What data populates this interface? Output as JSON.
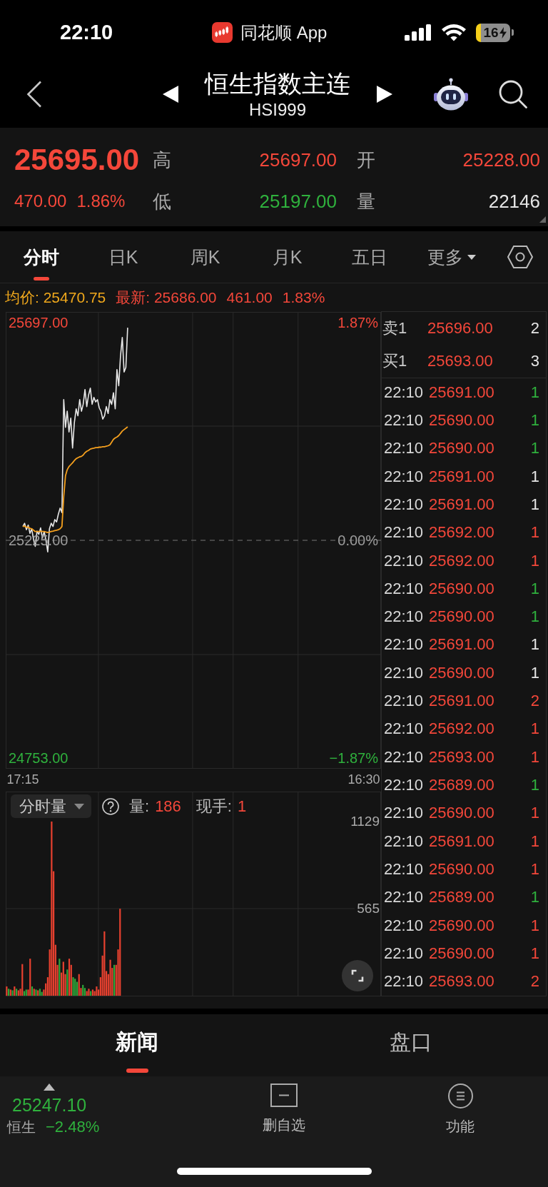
{
  "status_bar": {
    "time": "22:10",
    "app_label": "同花顺 App",
    "battery": "16"
  },
  "header": {
    "title": "恒生指数主连",
    "code": "HSI999"
  },
  "quote": {
    "price": "25695.00",
    "change": "470.00",
    "change_percent": "1.86%",
    "stats": [
      {
        "label": "高",
        "value": "25697.00",
        "color": "#f4473a"
      },
      {
        "label": "开",
        "value": "25228.00",
        "color": "#f4473a"
      },
      {
        "label": "低",
        "value": "25197.00",
        "color": "#2fb13d"
      },
      {
        "label": "量",
        "value": "22146",
        "color": "#e6e6e6"
      }
    ]
  },
  "chart_tabs": [
    {
      "label": "分时",
      "selected": true,
      "kind": "tab"
    },
    {
      "label": "日K",
      "selected": false,
      "kind": "tab"
    },
    {
      "label": "周K",
      "selected": false,
      "kind": "tab"
    },
    {
      "label": "月K",
      "selected": false,
      "kind": "tab"
    },
    {
      "label": "五日",
      "selected": false,
      "kind": "tab"
    },
    {
      "label": "更多",
      "selected": false,
      "kind": "menu"
    }
  ],
  "summary": {
    "average": "均价: 25470.75",
    "latest": "最新: 25686.00",
    "latest_change": "461.00",
    "latest_percent": "1.83%"
  },
  "price_chart": {
    "percent_labels": [
      {
        "text": "1.87%",
        "color": "#f4473a"
      },
      {
        "text": "0.00%",
        "color": "#9c9c9c"
      },
      {
        "text": "−1.87%",
        "color": "#2fb13d"
      }
    ],
    "chart_data": {
      "type": "line",
      "categories": [
        "17:15",
        null,
        null,
        null,
        null,
        null,
        null,
        null,
        null,
        null,
        null,
        null,
        null,
        null,
        null,
        null,
        null,
        null,
        null,
        null,
        null,
        null,
        null,
        null,
        null,
        null,
        null,
        null,
        null,
        null,
        null,
        null,
        null,
        null,
        null,
        null,
        null,
        null,
        null,
        null,
        null,
        null,
        null,
        null,
        null,
        null,
        null,
        null,
        null,
        null,
        null,
        null,
        null,
        null,
        null,
        null,
        null,
        null,
        null,
        null,
        null,
        null,
        null,
        null,
        null,
        null,
        null,
        null,
        null,
        null,
        null,
        null,
        null,
        null,
        null,
        null,
        null,
        null,
        null,
        null,
        null,
        null,
        null,
        null,
        null,
        null,
        null,
        null,
        null,
        null,
        null,
        null,
        null,
        null,
        null,
        null,
        null,
        null,
        null,
        null,
        null,
        null,
        null,
        null,
        null,
        null,
        null,
        null,
        null,
        null,
        null,
        null,
        null,
        null,
        null,
        null,
        null,
        null,
        null,
        null,
        null,
        null,
        null,
        null,
        null,
        null,
        null,
        null,
        null,
        null,
        null,
        null,
        null,
        null,
        null,
        null,
        null,
        null,
        null,
        null,
        null,
        null,
        null,
        null,
        null,
        null,
        null,
        null,
        null,
        null,
        null,
        null,
        null,
        null,
        null,
        null,
        null,
        null,
        null,
        null,
        null,
        null,
        null,
        null,
        null,
        null,
        null,
        null,
        null,
        null,
        null,
        null,
        null,
        null,
        null,
        null,
        null,
        null,
        null,
        null,
        null,
        null,
        null,
        null,
        null,
        null,
        null,
        null,
        null,
        null,
        null,
        null,
        "16:30"
      ],
      "ylim": [
        24753,
        25697
      ],
      "yticks": [
        {
          "value": 25697,
          "label": "25697.00"
        },
        {
          "value": 25225,
          "label": "25225.00"
        },
        {
          "value": 24753,
          "label": "24753.00"
        }
      ],
      "ref_lines": [
        {
          "axis": "y",
          "value": 25225
        }
      ],
      "series": [
        {
          "color": "#e8e8e8",
          "values": [
            25255,
            25262,
            25248,
            25258,
            25240,
            25250,
            25228,
            25212,
            25245,
            25238,
            25252,
            25230,
            25244,
            25225,
            25200,
            25250,
            25262,
            25255,
            25270,
            25265,
            25282,
            25295,
            25285,
            25530,
            25470,
            25505,
            25460,
            25490,
            25425,
            25480,
            25510,
            25495,
            25530,
            25505,
            25520,
            25552,
            25515,
            25540,
            25555,
            25520,
            25535,
            25525,
            25530,
            25512,
            25505,
            25488,
            25495,
            25515,
            25500,
            25530,
            25520,
            25545,
            25510,
            25595,
            25560,
            25625,
            25665,
            25590,
            25600,
            25686,
            null,
            null,
            null,
            null,
            null,
            null,
            null,
            null,
            null,
            null,
            null,
            null,
            null,
            null,
            null,
            null,
            null,
            null,
            null,
            null,
            null,
            null,
            null,
            null,
            null,
            null,
            null,
            null,
            null,
            null,
            null,
            null,
            null,
            null,
            null,
            null,
            null,
            null,
            null,
            null,
            null,
            null,
            null,
            null,
            null,
            null,
            null,
            null,
            null,
            null,
            null,
            null,
            null,
            null,
            null,
            null,
            null,
            null,
            null,
            null,
            null,
            null,
            null,
            null,
            null,
            null,
            null,
            null,
            null,
            null,
            null,
            null,
            null,
            null,
            null,
            null,
            null,
            null,
            null,
            null,
            null,
            null,
            null,
            null,
            null,
            null,
            null,
            null,
            null,
            null,
            null,
            null,
            null,
            null,
            null,
            null,
            null,
            null,
            null,
            null,
            null,
            null,
            null,
            null,
            null,
            null,
            null,
            null,
            null,
            null,
            null,
            null,
            null,
            null,
            null,
            null,
            null,
            null,
            null,
            null,
            null,
            null,
            null,
            null,
            null,
            null,
            null,
            null,
            null,
            null,
            null,
            null,
            null
          ]
        },
        {
          "color": "#f5a01e",
          "values": [
            25255,
            25256,
            25253,
            25254,
            25251,
            25250,
            25247,
            25244,
            25244,
            25244,
            25245,
            25244,
            25244,
            25243,
            25242,
            25243,
            25244,
            25245,
            25246,
            25247,
            25248,
            25250,
            25255,
            25320,
            25365,
            25378,
            25385,
            25389,
            25393,
            25398,
            25402,
            25404,
            25406,
            25407,
            25410,
            25415,
            25418,
            25420,
            25423,
            25424,
            25425,
            25426,
            25426,
            25427,
            25427,
            25428,
            25428,
            25429,
            25430,
            25432,
            25438,
            25444,
            25447,
            25449,
            25452,
            25457,
            25462,
            25465,
            25468,
            25471,
            null,
            null,
            null,
            null,
            null,
            null,
            null,
            null,
            null,
            null,
            null,
            null,
            null,
            null,
            null,
            null,
            null,
            null,
            null,
            null,
            null,
            null,
            null,
            null,
            null,
            null,
            null,
            null,
            null,
            null,
            null,
            null,
            null,
            null,
            null,
            null,
            null,
            null,
            null,
            null,
            null,
            null,
            null,
            null,
            null,
            null,
            null,
            null,
            null,
            null,
            null,
            null,
            null,
            null,
            null,
            null,
            null,
            null,
            null,
            null,
            null,
            null,
            null,
            null,
            null,
            null,
            null,
            null,
            null,
            null,
            null,
            null,
            null,
            null,
            null,
            null,
            null,
            null,
            null,
            null,
            null,
            null,
            null,
            null,
            null,
            null,
            null,
            null,
            null,
            null,
            null,
            null,
            null,
            null,
            null,
            null,
            null,
            null,
            null,
            null,
            null,
            null,
            null,
            null,
            null,
            null,
            null,
            null,
            null,
            null,
            null,
            null,
            null,
            null,
            null,
            null,
            null,
            null,
            null,
            null,
            null,
            null,
            null,
            null,
            null,
            null,
            null,
            null,
            null,
            null,
            null,
            null,
            null
          ]
        }
      ]
    }
  },
  "volume_chart": {
    "selector": "分时量",
    "volume_label": "量:",
    "volume_value": "186",
    "hand_label": "现手:",
    "hand_value": "1",
    "chart_data": {
      "type": "bar",
      "stacked": true,
      "categories": [
        null,
        null,
        null,
        null,
        null,
        null,
        null,
        null,
        null,
        null,
        null,
        null,
        null,
        null,
        null,
        null,
        null,
        null,
        null,
        null,
        null,
        null,
        null,
        null,
        null,
        null,
        null,
        null,
        null,
        null,
        null,
        null,
        null,
        null,
        null,
        null,
        null,
        null,
        null,
        null,
        null,
        null,
        null,
        null,
        null,
        null,
        null,
        null,
        null,
        null,
        null,
        null,
        null,
        null,
        null,
        null,
        null,
        null,
        null,
        null,
        null,
        null,
        null,
        null,
        null,
        null,
        null,
        null,
        null,
        null,
        null,
        null,
        null,
        null,
        null,
        null,
        null,
        null,
        null,
        null,
        null,
        null,
        null,
        null,
        null,
        null,
        null,
        null,
        null,
        null,
        null,
        null,
        null,
        null,
        null,
        null,
        null,
        null,
        null,
        null,
        null,
        null,
        null,
        null,
        null,
        null,
        null,
        null,
        null,
        null,
        null,
        null,
        null,
        null,
        null,
        null,
        null,
        null,
        null,
        null,
        null,
        null,
        null,
        null,
        null,
        null,
        null,
        null,
        null,
        null,
        null,
        null,
        null,
        null,
        null,
        null,
        null,
        null,
        null,
        null,
        null,
        null,
        null,
        null,
        null,
        null,
        null,
        null,
        null,
        null,
        null,
        null,
        null,
        null,
        null,
        null,
        null,
        null,
        null,
        null,
        null,
        null,
        null,
        null,
        null,
        null,
        null,
        null,
        null,
        null,
        null,
        null,
        null,
        null,
        null,
        null,
        null,
        null,
        null,
        null,
        null,
        null,
        null,
        null,
        null,
        null,
        null,
        null,
        null,
        null,
        null,
        null
      ],
      "ylim": [
        0,
        1129
      ],
      "yticks": [
        565,
        1129
      ],
      "series": [
        {
          "color": "#e8412f",
          "values": [
            60,
            null,
            40,
            null,
            60,
            null,
            35,
            45,
            205,
            null,
            null,
            40,
            240,
            null,
            45,
            null,
            35,
            null,
            null,
            40,
            80,
            120,
            300,
            1129,
            807,
            330,
            200,
            null,
            150,
            220,
            140,
            null,
            240,
            200,
            null,
            null,
            null,
            140,
            50,
            null,
            null,
            30,
            45,
            null,
            40,
            30,
            60,
            40,
            120,
            260,
            417,
            160,
            140,
            233,
            180,
            null,
            200,
            300,
            564,
            null,
            null,
            null,
            null,
            null,
            null,
            null,
            null,
            null,
            null,
            null,
            null,
            null,
            null,
            null,
            null,
            null,
            null,
            null,
            null,
            null,
            null,
            null,
            null,
            null,
            null,
            null,
            null,
            null,
            null,
            null,
            null,
            null,
            null,
            null,
            null,
            null,
            null,
            null,
            null,
            null,
            null,
            null,
            null,
            null,
            null,
            null,
            null,
            null,
            null,
            null,
            null,
            null,
            null,
            null,
            null,
            null,
            null,
            null,
            null,
            null,
            null,
            null,
            null,
            null,
            null,
            null,
            null,
            null,
            null,
            null,
            null,
            null,
            null,
            null,
            null,
            null,
            null,
            null,
            null,
            null,
            null,
            null,
            null,
            null,
            null,
            null,
            null,
            null,
            null,
            null,
            null,
            null,
            null,
            null,
            null,
            null,
            null,
            null,
            null,
            null,
            null,
            null,
            null,
            null,
            null,
            null,
            null,
            null,
            null,
            null,
            null,
            null,
            null,
            null,
            null,
            null,
            null,
            null,
            null,
            null,
            null,
            null,
            null,
            null,
            null,
            null,
            null,
            null,
            null,
            null,
            null,
            null
          ]
        },
        {
          "color": "#2ea83a",
          "values": [
            null,
            45,
            null,
            35,
            null,
            45,
            null,
            null,
            null,
            30,
            40,
            null,
            null,
            60,
            null,
            40,
            null,
            45,
            25,
            null,
            null,
            null,
            null,
            null,
            null,
            null,
            null,
            240,
            null,
            null,
            null,
            170,
            null,
            null,
            120,
            110,
            90,
            null,
            null,
            70,
            50,
            null,
            null,
            30,
            null,
            null,
            null,
            null,
            null,
            null,
            null,
            null,
            null,
            null,
            null,
            200,
            null,
            null,
            null,
            null,
            null,
            null,
            null,
            null,
            null,
            null,
            null,
            null,
            null,
            null,
            null,
            null,
            null,
            null,
            null,
            null,
            null,
            null,
            null,
            null,
            null,
            null,
            null,
            null,
            null,
            null,
            null,
            null,
            null,
            null,
            null,
            null,
            null,
            null,
            null,
            null,
            null,
            null,
            null,
            null,
            null,
            null,
            null,
            null,
            null,
            null,
            null,
            null,
            null,
            null,
            null,
            null,
            null,
            null,
            null,
            null,
            null,
            null,
            null,
            null,
            null,
            null,
            null,
            null,
            null,
            null,
            null,
            null,
            null,
            null,
            null,
            null,
            null,
            null,
            null,
            null,
            null,
            null,
            null,
            null,
            null,
            null,
            null,
            null,
            null,
            null,
            null,
            null,
            null,
            null,
            null,
            null,
            null,
            null,
            null,
            null,
            null,
            null,
            null,
            null,
            null,
            null,
            null,
            null,
            null,
            null,
            null,
            null,
            null,
            null,
            null,
            null,
            null,
            null,
            null,
            null,
            null,
            null,
            null,
            null,
            null,
            null,
            null,
            null,
            null,
            null,
            null,
            null,
            null,
            null,
            null,
            null
          ]
        }
      ]
    }
  },
  "order_book": [
    {
      "label": "卖1",
      "price": "25696.00",
      "volume": "2"
    },
    {
      "label": "买1",
      "price": "25693.00",
      "volume": "3"
    }
  ],
  "trades": [
    {
      "time": "22:10",
      "price": "25691.00",
      "volume": "1",
      "color": "#2fb13d"
    },
    {
      "time": "22:10",
      "price": "25690.00",
      "volume": "1",
      "color": "#2fb13d"
    },
    {
      "time": "22:10",
      "price": "25690.00",
      "volume": "1",
      "color": "#2fb13d"
    },
    {
      "time": "22:10",
      "price": "25691.00",
      "volume": "1",
      "color": "#e6e6e6"
    },
    {
      "time": "22:10",
      "price": "25691.00",
      "volume": "1",
      "color": "#e6e6e6"
    },
    {
      "time": "22:10",
      "price": "25692.00",
      "volume": "1",
      "color": "#f4473a"
    },
    {
      "time": "22:10",
      "price": "25692.00",
      "volume": "1",
      "color": "#f4473a"
    },
    {
      "time": "22:10",
      "price": "25690.00",
      "volume": "1",
      "color": "#2fb13d"
    },
    {
      "time": "22:10",
      "price": "25690.00",
      "volume": "1",
      "color": "#2fb13d"
    },
    {
      "time": "22:10",
      "price": "25691.00",
      "volume": "1",
      "color": "#e6e6e6"
    },
    {
      "time": "22:10",
      "price": "25690.00",
      "volume": "1",
      "color": "#e6e6e6"
    },
    {
      "time": "22:10",
      "price": "25691.00",
      "volume": "2",
      "color": "#f4473a"
    },
    {
      "time": "22:10",
      "price": "25692.00",
      "volume": "1",
      "color": "#f4473a"
    },
    {
      "time": "22:10",
      "price": "25693.00",
      "volume": "1",
      "color": "#f4473a"
    },
    {
      "time": "22:10",
      "price": "25689.00",
      "volume": "1",
      "color": "#2fb13d"
    },
    {
      "time": "22:10",
      "price": "25690.00",
      "volume": "1",
      "color": "#f4473a"
    },
    {
      "time": "22:10",
      "price": "25691.00",
      "volume": "1",
      "color": "#f4473a"
    },
    {
      "time": "22:10",
      "price": "25690.00",
      "volume": "1",
      "color": "#f4473a"
    },
    {
      "time": "22:10",
      "price": "25689.00",
      "volume": "1",
      "color": "#2fb13d"
    },
    {
      "time": "22:10",
      "price": "25690.00",
      "volume": "1",
      "color": "#f4473a"
    },
    {
      "time": "22:10",
      "price": "25690.00",
      "volume": "1",
      "color": "#f4473a"
    },
    {
      "time": "22:10",
      "price": "25693.00",
      "volume": "2",
      "color": "#f4473a"
    }
  ],
  "bottom_tabs": [
    {
      "label": "新闻",
      "selected": true
    },
    {
      "label": "盘口",
      "selected": false
    }
  ],
  "footer": {
    "index_value": "25247.10",
    "index_name": "恒生",
    "index_change": "−2.48%",
    "actions": [
      {
        "label": "删自选",
        "kind": "remove"
      },
      {
        "label": "功能",
        "kind": "menu"
      }
    ]
  }
}
